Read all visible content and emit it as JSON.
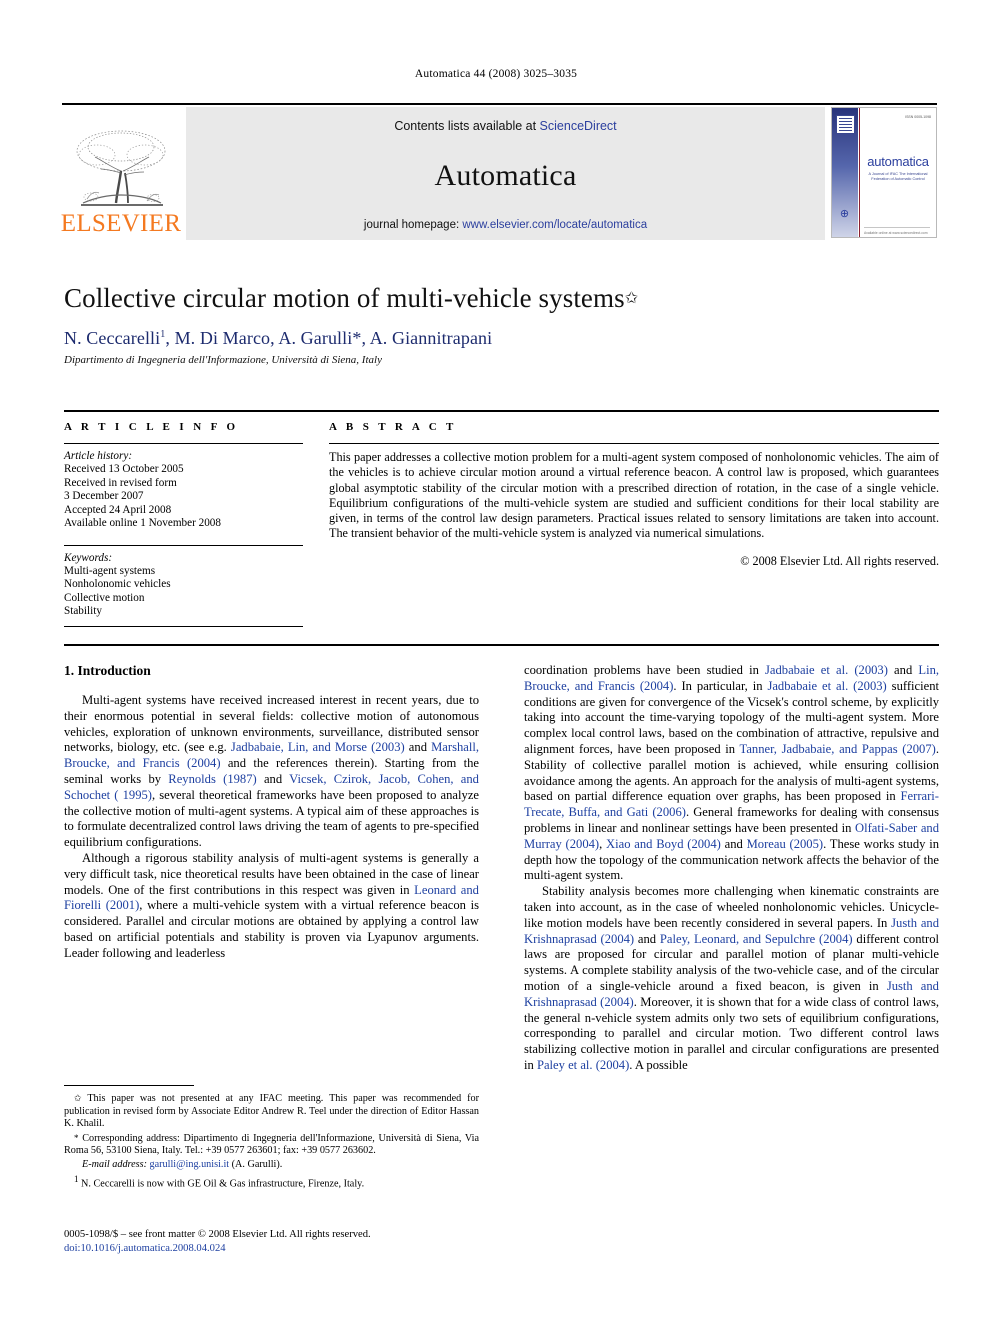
{
  "running_head": "Automatica 44 (2008) 3025–3035",
  "masthead": {
    "publisher_name": "ELSEVIER",
    "contents_prefix": "Contents lists available at ",
    "sciencedirect": "ScienceDirect",
    "journal_title": "Automatica",
    "homepage_prefix": "journal homepage: ",
    "homepage_url": "www.elsevier.com/locate/automatica",
    "cover": {
      "title": "automatica",
      "subtitle": "A Journal of IFAC The International Federation of Automatic Control",
      "top_code": "ISSN 0005-1098",
      "bottom_text": "Available online at www.sciencedirect.com"
    }
  },
  "article": {
    "title": "Collective circular motion of multi-vehicle systems",
    "title_footnote_mark": "✩",
    "authors": "N. Ceccarelli",
    "authors_full": "N. Ceccarelli 1, M. Di Marco, A. Garulli*, A. Giannitrapani",
    "author_parts": [
      {
        "name": "N. Ceccarelli",
        "mark": "1"
      },
      {
        "name": "M. Di Marco",
        "mark": ""
      },
      {
        "name": "A. Garulli",
        "mark": "*"
      },
      {
        "name": "A. Giannitrapani",
        "mark": ""
      }
    ],
    "affiliation": "Dipartimento di Ingegneria dell'Informazione, Università di Siena, Italy"
  },
  "article_info": {
    "heading": "A R T I C L E    I N F O",
    "history_label": "Article history:",
    "history": [
      "Received 13 October 2005",
      "Received in revised form",
      "3 December 2007",
      "Accepted 24 April 2008",
      "Available online 1 November 2008"
    ],
    "keywords_label": "Keywords:",
    "keywords": [
      "Multi-agent systems",
      "Nonholonomic vehicles",
      "Collective motion",
      "Stability"
    ]
  },
  "abstract": {
    "heading": "A B S T R A C T",
    "text": "This paper addresses a collective motion problem for a multi-agent system composed of nonholonomic vehicles. The aim of the vehicles is to achieve circular motion around a virtual reference beacon. A control law is proposed, which guarantees global asymptotic stability of the circular motion with a prescribed direction of rotation, in the case of a single vehicle. Equilibrium configurations of the multi-vehicle system are studied and sufficient conditions for their local stability are given, in terms of the control law design parameters. Practical issues related to sensory limitations are taken into account. The transient behavior of the multi-vehicle system is analyzed via numerical simulations.",
    "copyright": "© 2008 Elsevier Ltd. All rights reserved."
  },
  "body": {
    "section_title": "1. Introduction",
    "left_paragraphs": [
      {
        "runs": [
          {
            "t": "Multi-agent systems have received increased interest in recent years, due to their enormous potential in several fields: collective motion of autonomous vehicles, exploration of unknown environments, surveillance, distributed sensor networks, biology, etc. (see e.g. ",
            "c": false
          },
          {
            "t": "Jadbabaie, Lin, and Morse (2003)",
            "c": true
          },
          {
            "t": " and ",
            "c": false
          },
          {
            "t": "Marshall, Broucke, and Francis (2004)",
            "c": true
          },
          {
            "t": " and the references therein). Starting from the seminal works by ",
            "c": false
          },
          {
            "t": "Reynolds (1987)",
            "c": true
          },
          {
            "t": " and ",
            "c": false
          },
          {
            "t": "Vicsek, Czirok, Jacob, Cohen, and Schochet ( 1995)",
            "c": true
          },
          {
            "t": ", several theoretical frameworks have been proposed to analyze the collective motion of multi-agent systems. A typical aim of these approaches is to formulate decentralized control laws driving the team of agents to pre-specified equilibrium configurations.",
            "c": false
          }
        ]
      },
      {
        "runs": [
          {
            "t": "Although a rigorous stability analysis of multi-agent systems is generally a very difficult task, nice theoretical results have been obtained in the case of linear models. One of the first contributions in this respect was given in ",
            "c": false
          },
          {
            "t": "Leonard and Fiorelli (2001)",
            "c": true
          },
          {
            "t": ", where a multi-vehicle system with a virtual reference beacon is considered. Parallel and circular motions are obtained by applying a control law based on artificial potentials and stability is proven via Lyapunov arguments. Leader following and leaderless",
            "c": false
          }
        ]
      }
    ],
    "right_paragraphs": [
      {
        "runs": [
          {
            "t": "coordination problems have been studied in ",
            "c": false
          },
          {
            "t": "Jadbabaie et al. (2003)",
            "c": true
          },
          {
            "t": " and ",
            "c": false
          },
          {
            "t": "Lin, Broucke, and Francis (2004)",
            "c": true
          },
          {
            "t": ". In particular, in ",
            "c": false
          },
          {
            "t": "Jadbabaie et al. (2003)",
            "c": true
          },
          {
            "t": " sufficient conditions are given for convergence of the Vicsek's control scheme, by explicitly taking into account the time-varying topology of the multi-agent system. More complex local control laws, based on the combination of attractive, repulsive and alignment forces, have been proposed in ",
            "c": false
          },
          {
            "t": "Tanner, Jadbabaie, and Pappas (2007)",
            "c": true
          },
          {
            "t": ". Stability of collective parallel motion is achieved, while ensuring collision avoidance among the agents. An approach for the analysis of multi-agent systems, based on partial difference equation over graphs, has been proposed in ",
            "c": false
          },
          {
            "t": "Ferrari-Trecate, Buffa, and Gati (2006)",
            "c": true
          },
          {
            "t": ". General frameworks for dealing with consensus problems in linear and nonlinear settings have been presented in ",
            "c": false
          },
          {
            "t": "Olfati-Saber and Murray (2004)",
            "c": true
          },
          {
            "t": ", ",
            "c": false
          },
          {
            "t": "Xiao and Boyd (2004)",
            "c": true
          },
          {
            "t": " and ",
            "c": false
          },
          {
            "t": "Moreau (2005)",
            "c": true
          },
          {
            "t": ". These works study in depth how the topology of the communication network affects the behavior of the multi-agent system.",
            "c": false
          }
        ]
      },
      {
        "runs": [
          {
            "t": "Stability analysis becomes more challenging when kinematic constraints are taken into account, as in the case of wheeled nonholonomic vehicles. Unicycle-like motion models have been recently considered in several papers. In ",
            "c": false
          },
          {
            "t": "Justh and Krishnaprasad (2004)",
            "c": true
          },
          {
            "t": " and ",
            "c": false
          },
          {
            "t": "Paley, Leonard, and Sepulchre (2004)",
            "c": true
          },
          {
            "t": " different control laws are proposed for circular and parallel motion of planar multi-vehicle systems. A complete stability analysis of the two-vehicle case, and of the circular motion of a single-vehicle around a fixed beacon, is given in ",
            "c": false
          },
          {
            "t": "Justh and Krishnaprasad (2004)",
            "c": true
          },
          {
            "t": ". Moreover, it is shown that for a wide class of control laws, the general n-vehicle system admits only two sets of equilibrium configurations, corresponding to parallel and circular motion. Two different control laws stabilizing collective motion in parallel and circular configurations are presented in ",
            "c": false
          },
          {
            "t": "Paley et al. (2004)",
            "c": true
          },
          {
            "t": ". A possible",
            "c": false
          }
        ]
      }
    ]
  },
  "footnotes": [
    {
      "mark": "✩",
      "text": "This paper was not presented at any IFAC meeting. This paper was recommended for publication in revised form by Associate Editor Andrew R. Teel under the direction of Editor Hassan K. Khalil."
    },
    {
      "mark": "*",
      "text": "Corresponding address: Dipartimento di Ingegneria dell'Informazione, Università di Siena, Via Roma 56, 53100 Siena, Italy. Tel.: +39 0577 263601; fax: +39 0577 263602."
    }
  ],
  "email_footnote": {
    "label": "E-mail address:",
    "address": "garulli@ing.unisi.it",
    "suffix": "(A. Garulli)."
  },
  "numbered_footnote": {
    "mark": "1",
    "text": "N. Ceccarelli is now with GE Oil & Gas infrastructure, Firenze, Italy."
  },
  "imprint": {
    "issn_line": "0005-1098/$ – see front matter © 2008 Elsevier Ltd. All rights reserved.",
    "doi_line": "doi:10.1016/j.automatica.2008.04.024"
  },
  "colors": {
    "elsevier_orange": "#f47920",
    "link_blue": "#1d3fa0",
    "author_blue": "#1d2b6e",
    "masthead_gray": "#e9e9e9"
  }
}
